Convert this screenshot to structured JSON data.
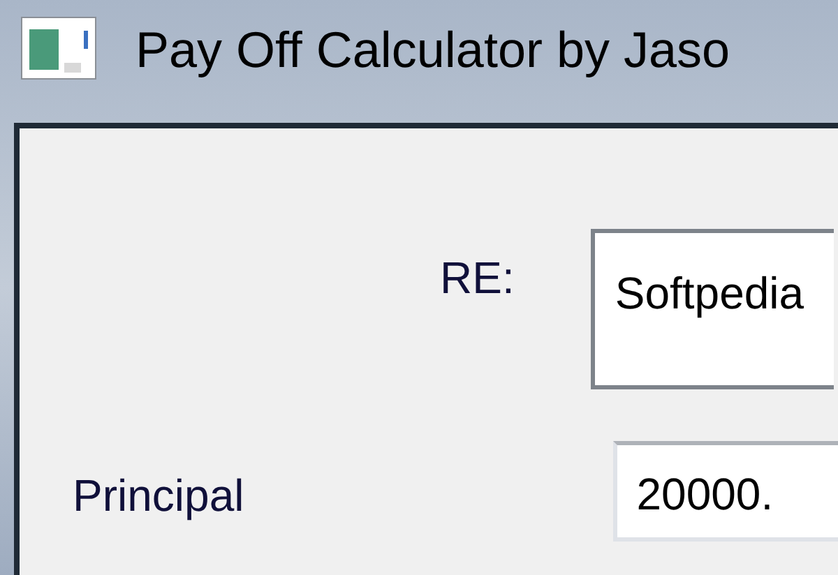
{
  "window": {
    "title": "Pay Off Calculator by Jaso"
  },
  "form": {
    "re_label": "RE:",
    "re_value": "Softpedia",
    "principal_label": "Principal",
    "principal_value": "20000."
  }
}
